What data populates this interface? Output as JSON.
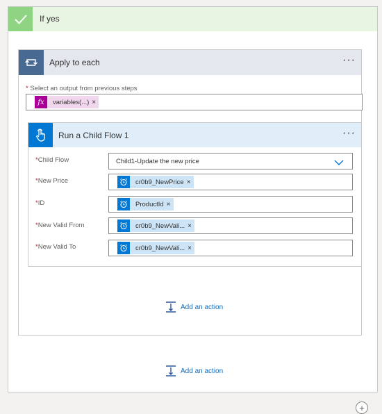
{
  "if_yes": {
    "title": "If yes"
  },
  "apply_to_each": {
    "title": "Apply to each",
    "more": "···",
    "select_label": "Select an output from previous steps",
    "required_marker": "*",
    "token": {
      "label": "variables(...)",
      "remove": "×",
      "icon": "fx-icon"
    }
  },
  "child_flow_action": {
    "title": "Run a Child Flow 1",
    "more": "···",
    "fields": [
      {
        "label": "Child Flow",
        "value": "Child1-Update the new price",
        "type": "dropdown"
      },
      {
        "label": "New Price",
        "token": "cr0b9_NewPrice",
        "remove": "×"
      },
      {
        "label": "ID",
        "token": "ProductId",
        "remove": "×"
      },
      {
        "label": "New Valid From",
        "token": "cr0b9_NewVali...",
        "remove": "×"
      },
      {
        "label": "New Valid To",
        "token": "cr0b9_NewVali...",
        "remove": "×"
      }
    ]
  },
  "add_action": {
    "label": "Add an action"
  },
  "add_action_outer": {
    "label": "Add an action"
  },
  "plus": "+",
  "colors": {
    "if_yes_green": "#8fd483",
    "loop_blue": "#486991",
    "child_blue": "#0078d4",
    "fx_purple": "#a80096",
    "link_blue": "#0f6cbd"
  }
}
